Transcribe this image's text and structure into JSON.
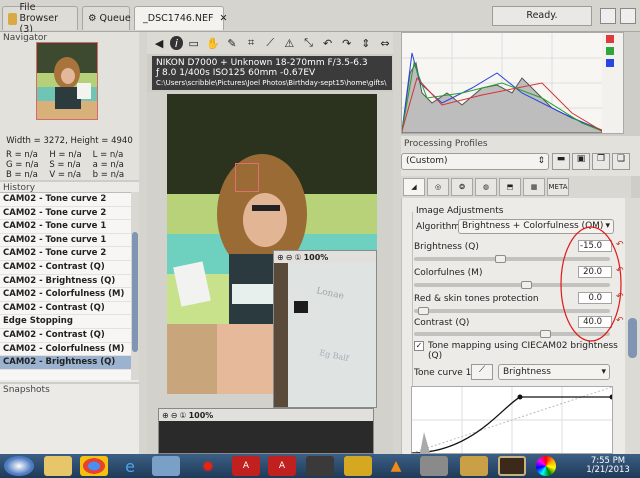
{
  "tabs": [
    {
      "label": "File Browser (3)",
      "icon": "folder-icon"
    },
    {
      "label": "Queue",
      "icon": "gear-icon"
    },
    {
      "label": "_DSC1746.NEF",
      "icon": "image-icon"
    }
  ],
  "status": "Ready.",
  "navigator": {
    "title": "Navigator",
    "size": "Width = 3272, Height = 4940",
    "values": [
      [
        "R = n/a",
        "H = n/a",
        "L = n/a"
      ],
      [
        "G = n/a",
        "S = n/a",
        "a = n/a"
      ],
      [
        "B = n/a",
        "V = n/a",
        "b = n/a"
      ]
    ]
  },
  "history": {
    "title": "History",
    "items": [
      "CAM02 - Tone curve 2",
      "CAM02 - Tone curve 2",
      "CAM02 - Tone curve 1",
      "CAM02 - Tone curve 1",
      "CAM02 - Tone curve 2",
      "CAM02 - Contrast (Q)",
      "CAM02 - Brightness (Q)",
      "CAM02 - Colorfulness (M)",
      "CAM02 - Contrast (Q)",
      "Edge Stopping",
      "CAM02 - Contrast (Q)",
      "CAM02 - Colorfulness (M)",
      "CAM02 - Brightness (Q)"
    ],
    "selected_index": 12
  },
  "snapshots": {
    "title": "Snapshots"
  },
  "exif": {
    "line1": "NIKON D7000 + Unknown 18-270mm F/3.5-6.3",
    "line2": "ƒ 8.0  1/400s  ISO125  60mm  -0.67EV",
    "path": "C:\\Users\\scribble\\Pictures\\Joel Photos\\Birthday-sept15\\home\\gifts\\"
  },
  "detail_windows": [
    {
      "zoom": "100%"
    },
    {
      "zoom": "100%"
    }
  ],
  "processing_profiles": {
    "title": "Processing Profiles",
    "selected": "(Custom)"
  },
  "image_adjustments": {
    "title": "Image Adjustments",
    "algorithm_label": "Algorithm:",
    "algorithm_value": "Brightness + Colorfulness (QM)",
    "sliders": [
      {
        "label": "Brightness (Q)",
        "value": "-15.0",
        "pos": 0.44
      },
      {
        "label": "Colorfulnes (M)",
        "value": "20.0",
        "pos": 0.58
      },
      {
        "label": "Red & skin tones protection",
        "value": "0.0",
        "pos": 0.02
      },
      {
        "label": "Contrast (Q)",
        "value": "40.0",
        "pos": 0.68
      }
    ],
    "tone_mapping_label": "Tone mapping using CIECAM02 brightness (Q)",
    "tone_mapping_checked": true,
    "tone_curve_label": "Tone curve 1:",
    "tone_curve_mode": "Brightness"
  },
  "taskbar": {
    "time": "7:55 PM",
    "date": "1/21/2013",
    "apps": [
      "windows-start-icon",
      "explorer-icon",
      "chrome-icon",
      "ie-icon",
      "photos-icon",
      "starburst-icon",
      "pdf-icon",
      "pdf-icon",
      "terminal-icon",
      "stamp-icon",
      "vlc-icon",
      "tools-icon",
      "folder-icon",
      "frame-icon",
      "color-wheel-icon"
    ]
  }
}
